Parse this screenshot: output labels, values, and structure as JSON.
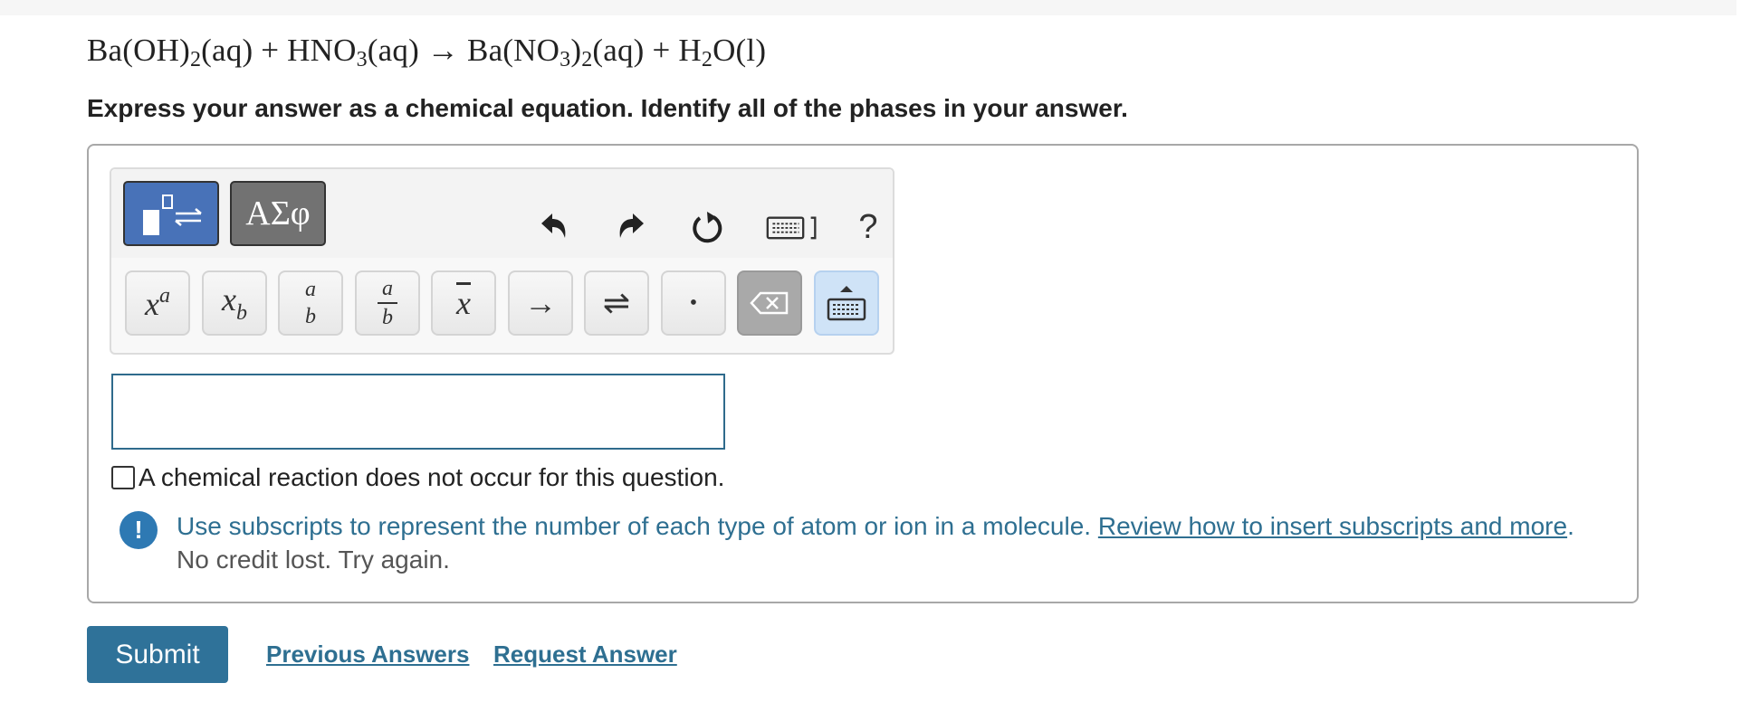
{
  "question": {
    "equation": {
      "t1": "Ba(OH)",
      "s1": "2",
      "t2": "(aq) + HNO",
      "s2": "3",
      "t3": "(aq) → Ba(NO",
      "s3": "3",
      "t4": ")",
      "s4": "2",
      "t5": "(aq) + H",
      "s5": "2",
      "t6": "O(l)"
    },
    "instruction": "Express your answer as a chemical equation. Identify all of the phases in your answer."
  },
  "toolbar": {
    "mode_greek_label": "ΑΣφ",
    "help_label": "?",
    "keys": {
      "superscript_base": "x",
      "superscript_exp": "a",
      "subscript_base": "x",
      "subscript_exp": "b",
      "stack_top": "a",
      "stack_bottom": "b",
      "fraction_top": "a",
      "fraction_bottom": "b",
      "overline": "x",
      "arrow": "→",
      "equilibrium": "⇌",
      "dot": "•"
    }
  },
  "answer_input": {
    "value": ""
  },
  "no_reaction": {
    "checked": false,
    "label": "A chemical reaction does not occur for this question."
  },
  "feedback": {
    "message": "Use subscripts to represent the number of each type of atom or ion in a molecule. ",
    "link": "Review how to insert subscripts and more",
    "end": ".",
    "sub": "No credit lost. Try again."
  },
  "actions": {
    "submit": "Submit",
    "previous_answers": "Previous Answers",
    "request_answer": "Request Answer"
  }
}
